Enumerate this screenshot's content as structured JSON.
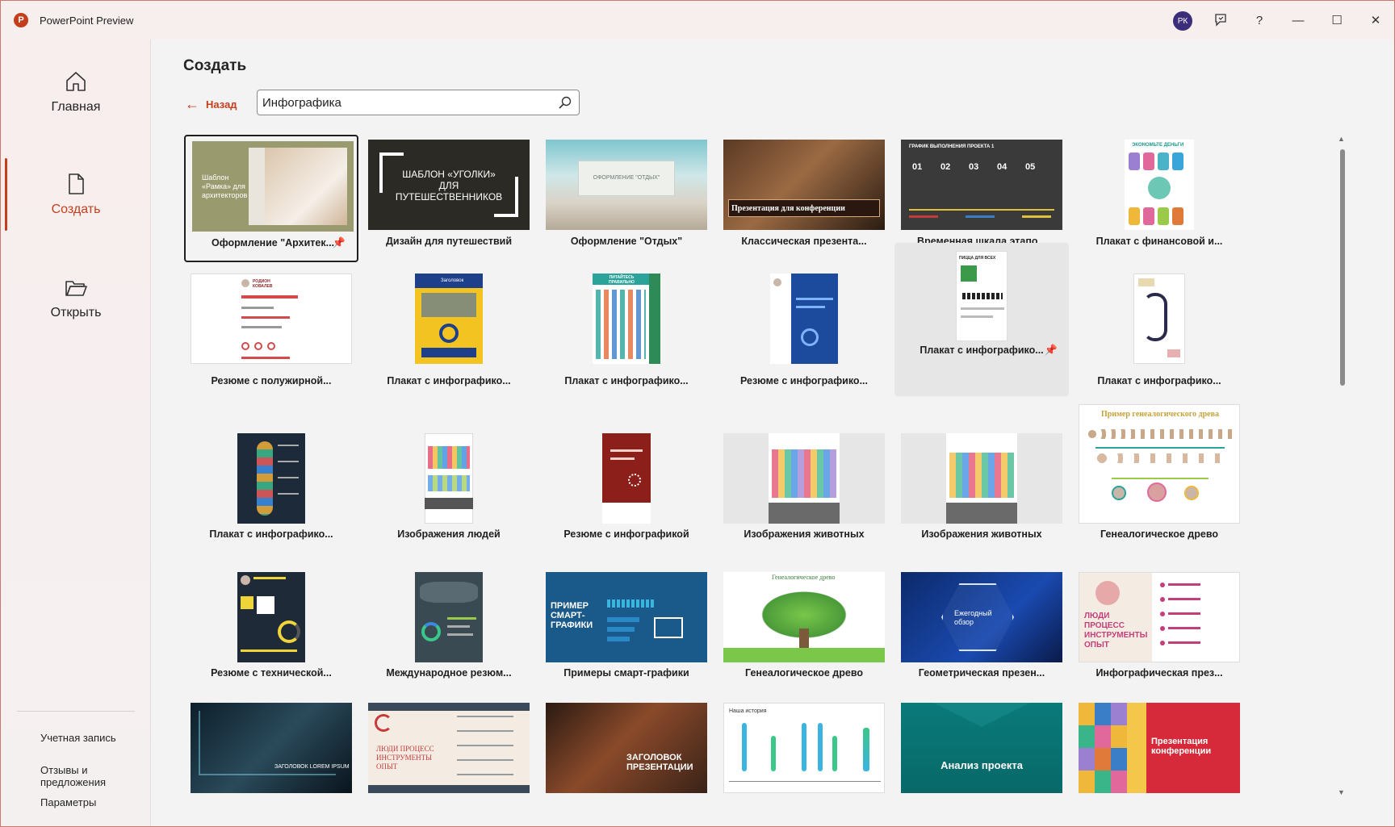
{
  "app": {
    "title": "PowerPoint Preview",
    "logo_letter": "P",
    "avatar_initials": "РК",
    "accent": "#c43e1c"
  },
  "titlebar": {
    "feedback_icon": "feedback-icon",
    "help_label": "?",
    "minimize_label": "—",
    "maximize_label": "☐",
    "close_label": "✕"
  },
  "sidebar": {
    "items": [
      {
        "label": "Главная",
        "icon": "home-icon"
      },
      {
        "label": "Создать",
        "icon": "new-document-icon"
      },
      {
        "label": "Открыть",
        "icon": "folder-open-icon"
      }
    ],
    "bottom_links": [
      "Учетная запись",
      "Отзывы и предложения",
      "Параметры"
    ]
  },
  "main": {
    "page_title": "Создать",
    "back_label": "Назад",
    "search_value": "Инфографика"
  },
  "templates": [
    {
      "label": "Оформление \"Архитек...",
      "thumb_text": "Шаблон «Рамка» для архитекторов",
      "pinned": true
    },
    {
      "label": "Дизайн для путешествий",
      "thumb_text": "ШАБЛОН «УГОЛКИ» ДЛЯ ПУТЕШЕСТВЕННИКОВ"
    },
    {
      "label": "Оформление \"Отдых\"",
      "thumb_text": "ОФОРМЛЕНИЕ \"ОТДЫХ\""
    },
    {
      "label": "Классическая презента...",
      "thumb_text": "Презентация для конференции"
    },
    {
      "label": "Временная шкала этапо...",
      "thumb_text": "ГРАФИК ВЫПОЛНЕНИЯ ПРОЕКТА 1",
      "thumb_nums": [
        "01",
        "02",
        "03",
        "04",
        "05"
      ]
    },
    {
      "label": "Плакат с финансовой и...",
      "thumb_text": "ЭКОНОМЬТЕ ДЕНЬГИ"
    },
    {
      "label": "Резюме с полужирной...",
      "thumb_text": "РОДИОН КОВАЛЕВ"
    },
    {
      "label": "Плакат с инфографико...",
      "thumb_text": "Заголовок"
    },
    {
      "label": "Плакат с инфографико...",
      "thumb_text": "ПИТАЙТЕСЬ ПРАВИЛЬНО"
    },
    {
      "label": "Резюме с инфографико...",
      "thumb_text": ""
    },
    {
      "label": "Плакат с инфографико...",
      "thumb_text": "ПИЦЦА ДЛЯ ВСЕХ",
      "pinned": true
    },
    {
      "label": "Плакат с инфографико...",
      "thumb_text": ""
    },
    {
      "label": "Плакат с инфографико...",
      "thumb_text": ""
    },
    {
      "label": "Изображения людей",
      "thumb_text": ""
    },
    {
      "label": "Резюме с инфографикой",
      "thumb_text": ""
    },
    {
      "label": "Изображения животных",
      "thumb_text": ""
    },
    {
      "label": "Изображения животных",
      "thumb_text": ""
    },
    {
      "label": "Генеалогическое древо",
      "thumb_text": "Пример генеалогического древа"
    },
    {
      "label": "Резюме с технической...",
      "thumb_text": ""
    },
    {
      "label": "Международное резюм...",
      "thumb_text": ""
    },
    {
      "label": "Примеры смарт-графики",
      "thumb_text": "ПРИМЕР СМАРТ-ГРАФИКИ"
    },
    {
      "label": "Генеалогическое древо",
      "thumb_text": "Генеалогическое древо"
    },
    {
      "label": "Геометрическая презен...",
      "thumb_text": "Ежегодный обзор"
    },
    {
      "label": "Инфографическая през...",
      "thumb_text": "ЛЮДИ ПРОЦЕСС ИНСТРУМЕНТЫ ОПЫТ"
    },
    {
      "label": "",
      "thumb_text": "ЗАГОЛОВОК LOREM IPSUM"
    },
    {
      "label": "",
      "thumb_text": "ЛЮДИ ПРОЦЕСС ИНСТРУМЕНТЫ ОПЫТ"
    },
    {
      "label": "",
      "thumb_text": "ЗАГОЛОВОК ПРЕЗЕНТАЦИИ"
    },
    {
      "label": "",
      "thumb_text": "Наша история"
    },
    {
      "label": "",
      "thumb_text": "Анализ проекта"
    },
    {
      "label": "",
      "thumb_text": "Презентация конференции"
    }
  ]
}
